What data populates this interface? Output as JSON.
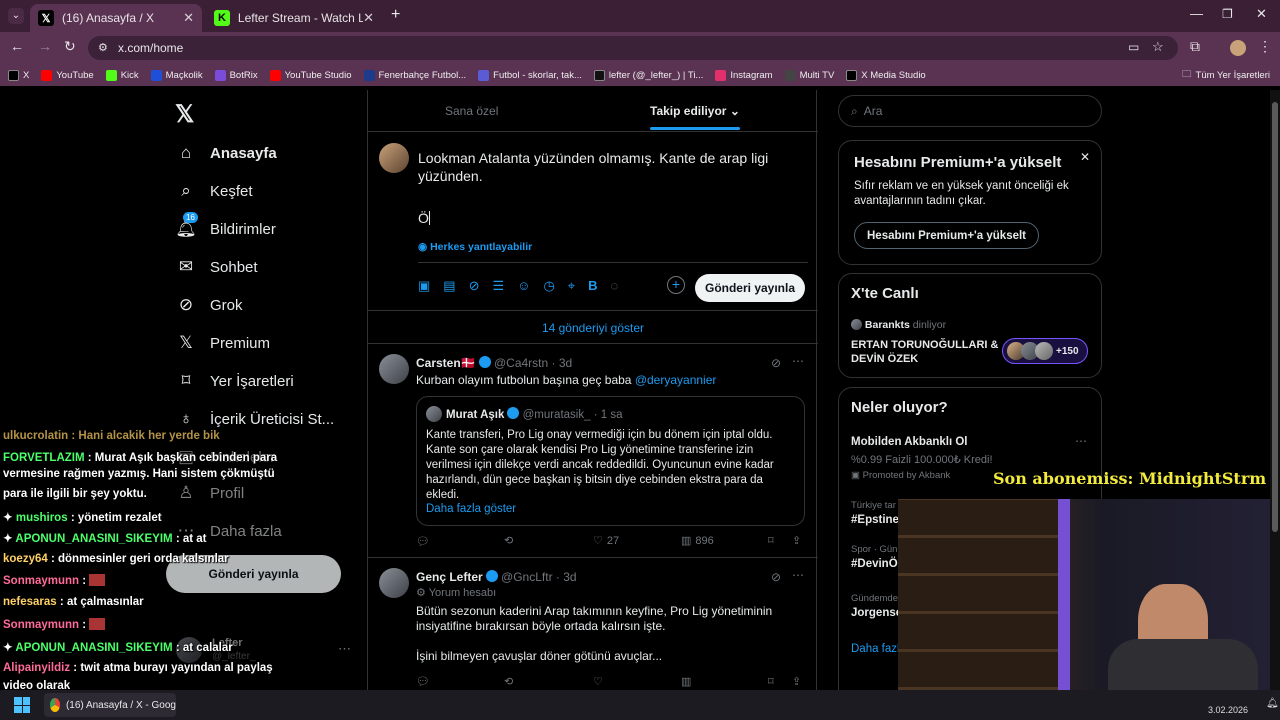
{
  "browser": {
    "tabs": [
      {
        "title": "(16) Anasayfa / X",
        "icon": "x-logo-icon"
      },
      {
        "title": "Lefter Stream - Watch Live on K",
        "icon": "kick-icon"
      }
    ],
    "url": "x.com/home",
    "bookmarks": [
      {
        "label": "X",
        "color": "#000000"
      },
      {
        "label": "YouTube",
        "color": "#ff0000"
      },
      {
        "label": "Kick",
        "color": "#53fc18"
      },
      {
        "label": "Maçkolik",
        "color": "#1e4fd8"
      },
      {
        "label": "BotRix",
        "color": "#7b4bd9"
      },
      {
        "label": "YouTube Studio",
        "color": "#ff0000"
      },
      {
        "label": "Fenerbahçe Futbol...",
        "color": "#1e3a8a"
      },
      {
        "label": "Futbol - skorlar, tak...",
        "color": "#5b5bd6"
      },
      {
        "label": "lefter (@_lefter_) | Ti...",
        "color": "#111111"
      },
      {
        "label": "Instagram",
        "color": "#e1306c"
      },
      {
        "label": "Multi TV",
        "color": "#444444"
      },
      {
        "label": "X Media Studio",
        "color": "#000000"
      }
    ],
    "all_bookmarks": "Tüm Yer İşaretleri"
  },
  "nav": {
    "items": [
      {
        "label": "Anasayfa",
        "icon": "home-icon"
      },
      {
        "label": "Keşfet",
        "icon": "search-icon"
      },
      {
        "label": "Bildirimler",
        "icon": "bell-icon",
        "badge": "16"
      },
      {
        "label": "Sohbet",
        "icon": "mail-icon"
      },
      {
        "label": "Grok",
        "icon": "grok-icon"
      },
      {
        "label": "Premium",
        "icon": "x-logo-icon"
      },
      {
        "label": "Yer İşaretleri",
        "icon": "bookmark-icon"
      },
      {
        "label": "İçerik Üreticisi St...",
        "icon": "creator-icon"
      },
      {
        "label": "Makaleler",
        "icon": "article-icon"
      },
      {
        "label": "Profil",
        "icon": "profile-icon"
      },
      {
        "label": "Daha fazla",
        "icon": "more-icon"
      }
    ],
    "post_button": "Gönderi yayınla",
    "account_name": "Lefter",
    "account_handle": "@_lefter_"
  },
  "timeline": {
    "tab_for_you": "Sana özel",
    "tab_following": "Takip ediliyor",
    "compose_text": "Lookman Atalanta yüzünden olmamış. Kante de arap ligi yüzünden.",
    "compose_cursor_text": "Ö",
    "reply_setting": "Herkes yanıtlayabilir",
    "post_button": "Gönderi yayınla",
    "show_more": "14 gönderiyi göster",
    "tweets": [
      {
        "name": "Carsten🇩🇰",
        "handle": "@Ca4rstn",
        "time": "· 3d",
        "text": "Kurban olayım futbolun başına geç baba",
        "mention": "@deryayannier",
        "quote": {
          "name": "Murat Aşık",
          "handle": "@muratasik_",
          "time": "· 1 sa",
          "text": "Kante transferi, Pro Lig onay vermediği için bu dönem için iptal oldu. Kante son çare olarak kendisi Pro Lig yönetimine transferine izin verilmesi için dilekçe verdi ancak reddedildi. Oyuncunun evine kadar hazırlandı, dün gece başkan iş bitsin diye cebinden ekstra para da ekledi.",
          "more": "Daha fazla göster"
        },
        "likes": "27",
        "views": "896"
      },
      {
        "name": "Genç Lefter",
        "handle": "@GncLftr",
        "time": "· 3d",
        "subtitle": "Yorum hesabı",
        "text1": "Bütün sezonun kaderini Arap takımının keyfine, Pro Lig yönetiminin insiyatifine bırakırsan böyle ortada kalırsın işte.",
        "text2": "İşini bilmeyen çavuşlar döner götünü avuçlar..."
      }
    ]
  },
  "right": {
    "search_placeholder": "Ara",
    "premium_title": "Hesabını Premium+'a yükselt",
    "premium_desc": "Sıfır reklam ve en yüksek yanıt önceliği ek avantajlarının tadını çıkar.",
    "premium_button": "Hesabını Premium+'a yükselt",
    "live_title": "X'te Canlı",
    "live_host": "Barankts",
    "live_host_suffix": "dinliyor",
    "live_show": "ERTAN TORUNOĞULLARI & DEVİN ÖZEK",
    "live_count": "+150",
    "trends_title": "Neler oluyor?",
    "promo_title": "Mobilden Akbanklı Ol",
    "promo_desc": "%0.99 Faizli 100.000₺ Kredi!",
    "promo_by": "Promoted by Akbank",
    "trends": [
      {
        "meta": "Türkiye tar",
        "name": "#Epstine"
      },
      {
        "meta": "Spor · Günd",
        "name": "#DevinÖ"
      },
      {
        "meta": "Gündemde",
        "name": "Jorgense"
      }
    ],
    "more": "Daha fazl"
  },
  "overlay": {
    "sub_banner": "Son abonemiss: MidnightStrm",
    "chat": [
      {
        "user": "",
        "msg": "ulkucrolatin : Hani alcakik her yerde bik",
        "color": "#ffd166"
      },
      {
        "user": "FORVETLAZIM",
        "msg": ": Murat Aşık başkan cebinden para",
        "color": "#4cff6b"
      },
      {
        "user": "",
        "msg": "vermesine rağmen yazmış. Hani sistem çökmüştü",
        "color": "#ffffff"
      },
      {
        "user": "",
        "msg": "para ile ilgili bir şey yoktu.",
        "color": "#ffffff"
      },
      {
        "user": "mushiros",
        "msg": ": yönetim rezalet",
        "color": "#4cff6b"
      },
      {
        "user": "APONUN_ANASINI_SIKEYIM",
        "msg": ": at at",
        "color": "#4cff6b"
      },
      {
        "user": "koezy64",
        "msg": ": dönmesinler geri orda kalsınlar",
        "color": "#ffd166"
      },
      {
        "user": "Sonmaymunn",
        "msg": ":",
        "color": "#ff6b9a"
      },
      {
        "user": "nefesaras",
        "msg": ": at çalmasınlar",
        "color": "#ffd166"
      },
      {
        "user": "Sonmaymunn",
        "msg": ":",
        "color": "#ff6b9a"
      },
      {
        "user": "APONUN_ANASINI_SIKEYIM",
        "msg": ": at calalar",
        "color": "#4cff6b"
      },
      {
        "user": "Alipainyildiz",
        "msg": ": twit atma burayı yayından al paylaş",
        "color": "#ff6b9a"
      },
      {
        "user": "",
        "msg": "video olarak",
        "color": "#ffffff"
      }
    ]
  },
  "taskbar": {
    "app": "(16) Anasayfa / X - Goog",
    "date": "3.02.2026"
  }
}
